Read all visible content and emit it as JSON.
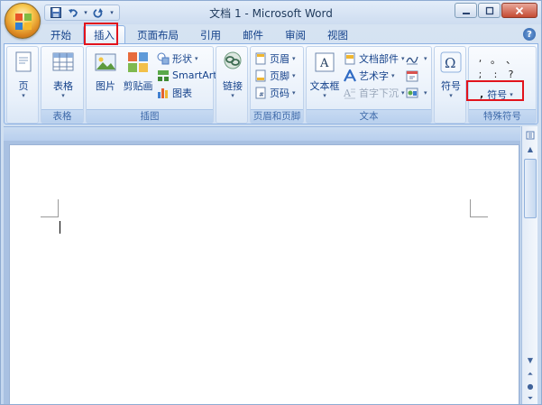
{
  "window": {
    "title": "文档 1 - Microsoft Word"
  },
  "qat": {
    "save_icon": "save-icon",
    "undo_icon": "undo-icon",
    "redo_icon": "redo-icon"
  },
  "tabs": [
    {
      "label": "开始"
    },
    {
      "label": "插入"
    },
    {
      "label": "页面布局"
    },
    {
      "label": "引用"
    },
    {
      "label": "邮件"
    },
    {
      "label": "审阅"
    },
    {
      "label": "视图"
    }
  ],
  "active_tab": "插入",
  "ribbon": {
    "pages": {
      "btn": "页"
    },
    "tables": {
      "btn": "表格",
      "group": "表格"
    },
    "illustrations": {
      "picture": "图片",
      "clipart": "剪贴画",
      "shapes": "形状",
      "smartart": "SmartArt",
      "chart": "图表",
      "group": "插图"
    },
    "links": {
      "btn": "链接"
    },
    "header_footer": {
      "header": "页眉",
      "footer": "页脚",
      "page_number": "页码",
      "group": "页眉和页脚"
    },
    "text": {
      "textbox": "文本框",
      "quick_parts": "文档部件",
      "wordart": "艺术字",
      "dropcap": "首字下沉",
      "group": "文本"
    },
    "symbols": {
      "btn": "符号"
    },
    "special": {
      "row1": [
        ",",
        "。",
        "、",
        ""
      ],
      "row2": [
        ";",
        ":",
        "?",
        ""
      ],
      "symbol_btn": "符号",
      "group": "特殊符号"
    }
  },
  "colors": {
    "highlight": "#e2131c",
    "ribbon_text": "#15428b"
  }
}
